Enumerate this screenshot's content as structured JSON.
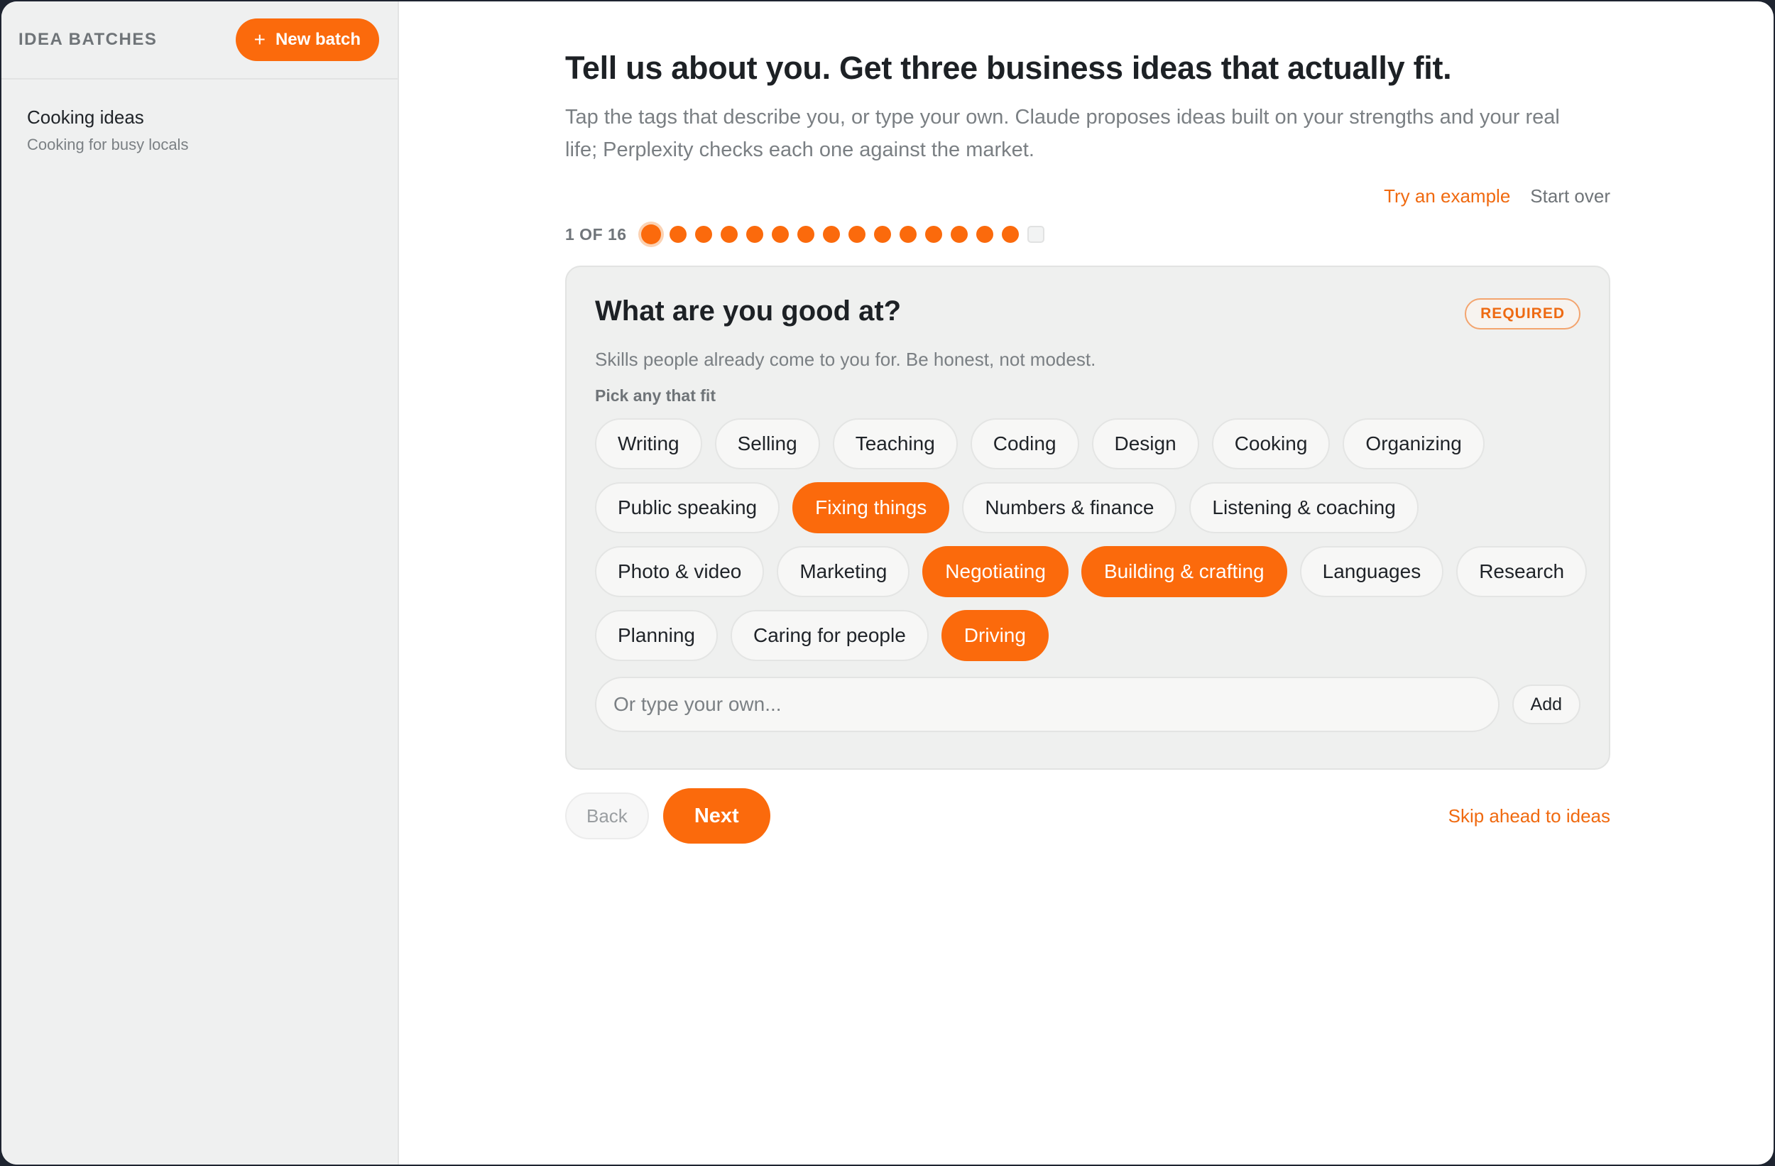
{
  "sidebar": {
    "title": "IDEA BATCHES",
    "new_batch_label": "New batch",
    "batches": [
      {
        "title": "Cooking ideas",
        "subtitle": "Cooking for busy locals"
      }
    ]
  },
  "header": {
    "title": "Tell us about you. Get three business ideas that actually fit.",
    "description": "Tap the tags that describe you, or type your own. Claude proposes ideas built on your strengths and your real life; Perplexity checks each one against the market."
  },
  "top_links": {
    "try_example": "Try an example",
    "start_over": "Start over"
  },
  "progress": {
    "label": "1 OF 16",
    "current": 1,
    "total": 16,
    "completed_steps": 15
  },
  "question": {
    "title": "What are you good at?",
    "badge": "REQUIRED",
    "subtitle": "Skills people already come to you for. Be honest, not modest.",
    "pick_label": "Pick any that fit",
    "tags": [
      {
        "label": "Writing",
        "selected": false
      },
      {
        "label": "Selling",
        "selected": false
      },
      {
        "label": "Teaching",
        "selected": false
      },
      {
        "label": "Coding",
        "selected": false
      },
      {
        "label": "Design",
        "selected": false
      },
      {
        "label": "Cooking",
        "selected": false
      },
      {
        "label": "Organizing",
        "selected": false
      },
      {
        "label": "Public speaking",
        "selected": false
      },
      {
        "label": "Fixing things",
        "selected": true
      },
      {
        "label": "Numbers & finance",
        "selected": false
      },
      {
        "label": "Listening & coaching",
        "selected": false
      },
      {
        "label": "Photo & video",
        "selected": false
      },
      {
        "label": "Marketing",
        "selected": false
      },
      {
        "label": "Negotiating",
        "selected": true
      },
      {
        "label": "Building & crafting",
        "selected": true
      },
      {
        "label": "Languages",
        "selected": false
      },
      {
        "label": "Research",
        "selected": false
      },
      {
        "label": "Planning",
        "selected": false
      },
      {
        "label": "Caring for people",
        "selected": false
      },
      {
        "label": "Driving",
        "selected": true
      }
    ],
    "input_placeholder": "Or type your own...",
    "input_value": "",
    "add_label": "Add"
  },
  "nav": {
    "back_label": "Back",
    "next_label": "Next",
    "skip_label": "Skip ahead to ideas"
  },
  "colors": {
    "accent": "#fb6a0c",
    "sidebar_bg": "#eff0f0",
    "card_bg": "#eff0ef"
  }
}
